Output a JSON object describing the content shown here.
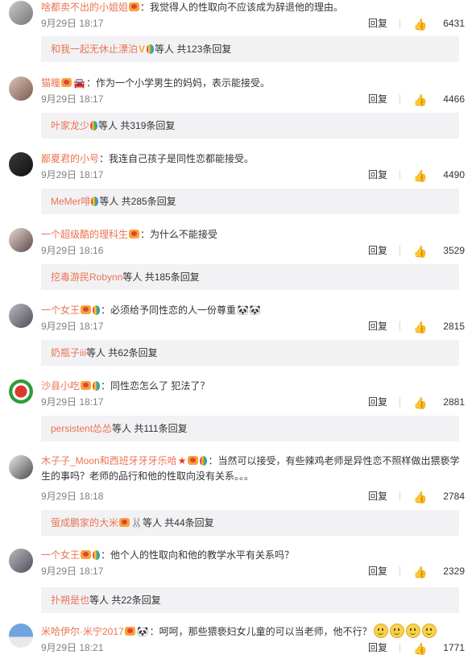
{
  "comments": [
    {
      "user": "啥都卖不出的小姐姐",
      "text": "：我觉得人的性取向不应该成为辞退他的理由。",
      "time": "9月29日 18:17",
      "reply_label": "回复",
      "likes": "6431",
      "sub": {
        "name": "和我一起无休止漂泊",
        "suffix": "等人 共123条回复"
      }
    },
    {
      "user": "猫瞳",
      "text": "：作为一个小学男生的妈妈，表示能接受。",
      "time": "9月29日 18:17",
      "reply_label": "回复",
      "likes": "4466",
      "sub": {
        "name": "叶家龙少",
        "suffix": "等人 共319条回复"
      }
    },
    {
      "user": "鄙夏君的小号",
      "text": "：我连自己孩子是同性恋都能接受。",
      "time": "9月29日 18:17",
      "reply_label": "回复",
      "likes": "4490",
      "sub": {
        "name": "MeMer啡",
        "suffix": "等人 共285条回复"
      }
    },
    {
      "user": "一个超级酷的理科生",
      "text": "：为什么不能接受",
      "time": "9月29日 18:16",
      "reply_label": "回复",
      "likes": "3529",
      "sub": {
        "name": "挖毒游民Robynn",
        "suffix": "等人 共185条回复"
      }
    },
    {
      "user": "一个女王",
      "text": "：必须给予同性恋的人一份尊重",
      "time": "9月29日 18:17",
      "reply_label": "回复",
      "likes": "2815",
      "sub": {
        "name": "奶瓶子iii",
        "suffix": "等人 共62条回复"
      }
    },
    {
      "user": "沙县小吃",
      "text": "：同性恋怎么了 犯法了？",
      "time": "9月29日 18:17",
      "reply_label": "回复",
      "likes": "2881",
      "sub": {
        "name": "persistent怂怂",
        "suffix": "等人 共111条回复"
      }
    },
    {
      "user": "木子子_Moon和西班牙牙牙乐哈",
      "text": "：当然可以接受，有些辣鸡老师是异性恋不照样做出猥亵学生的事吗？老师的品行和他的性取向没有关系。。。",
      "time": "9月29日 18:18",
      "reply_label": "回复",
      "likes": "2784",
      "sub": {
        "name": "萤成鹏家的大米",
        "suffix": "等人 共44条回复"
      }
    },
    {
      "user": "一个女王",
      "text": "：他个人的性取向和他的教学水平有关系吗？",
      "time": "9月29日 18:17",
      "reply_label": "回复",
      "likes": "2329",
      "sub": {
        "name": "扑朔是也",
        "suffix": "等人 共22条回复"
      }
    },
    {
      "user": "米哈伊尔·米宁2017",
      "text": "：呵呵，那些猥亵妇女儿童的可以当老师，他不行？",
      "time": "9月29日 18:21",
      "reply_label": "回复",
      "likes": "1771"
    }
  ],
  "icons": {
    "like": "thumbs-up-icon",
    "badge": "vip-badge-icon",
    "balloon": "rainbow-balloon-icon"
  },
  "colors": {
    "username": "#eb7350",
    "subbox_bg": "#f2f2f5",
    "meta": "#808080"
  }
}
